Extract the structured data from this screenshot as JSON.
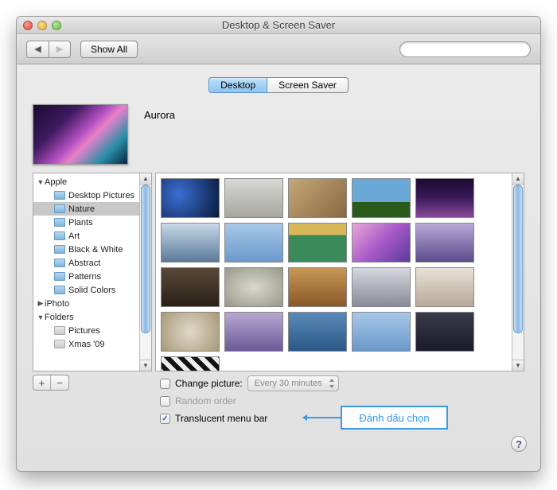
{
  "window": {
    "title": "Desktop & Screen Saver"
  },
  "toolbar": {
    "show_all": "Show All",
    "search_placeholder": ""
  },
  "tabs": {
    "desktop": "Desktop",
    "screensaver": "Screen Saver"
  },
  "current_picture": {
    "name": "Aurora"
  },
  "sidebar": {
    "groups": [
      {
        "label": "Apple",
        "expanded": true,
        "children": [
          {
            "label": "Desktop Pictures"
          },
          {
            "label": "Nature",
            "selected": true
          },
          {
            "label": "Plants"
          },
          {
            "label": "Art"
          },
          {
            "label": "Black & White"
          },
          {
            "label": "Abstract"
          },
          {
            "label": "Patterns"
          },
          {
            "label": "Solid Colors"
          }
        ]
      },
      {
        "label": "iPhoto",
        "expanded": false
      },
      {
        "label": "Folders",
        "expanded": true,
        "children": [
          {
            "label": "Pictures",
            "light": true
          },
          {
            "label": "Xmas '09",
            "light": true
          }
        ]
      }
    ]
  },
  "options": {
    "change_picture_label": "Change picture:",
    "change_picture_checked": false,
    "interval": "Every 30 minutes",
    "random_label": "Random order",
    "random_checked": false,
    "translucent_label": "Translucent menu bar",
    "translucent_checked": true
  },
  "buttons": {
    "add": "+",
    "remove": "−",
    "help": "?"
  },
  "annotation": {
    "text": "Đánh dấu chọn"
  }
}
